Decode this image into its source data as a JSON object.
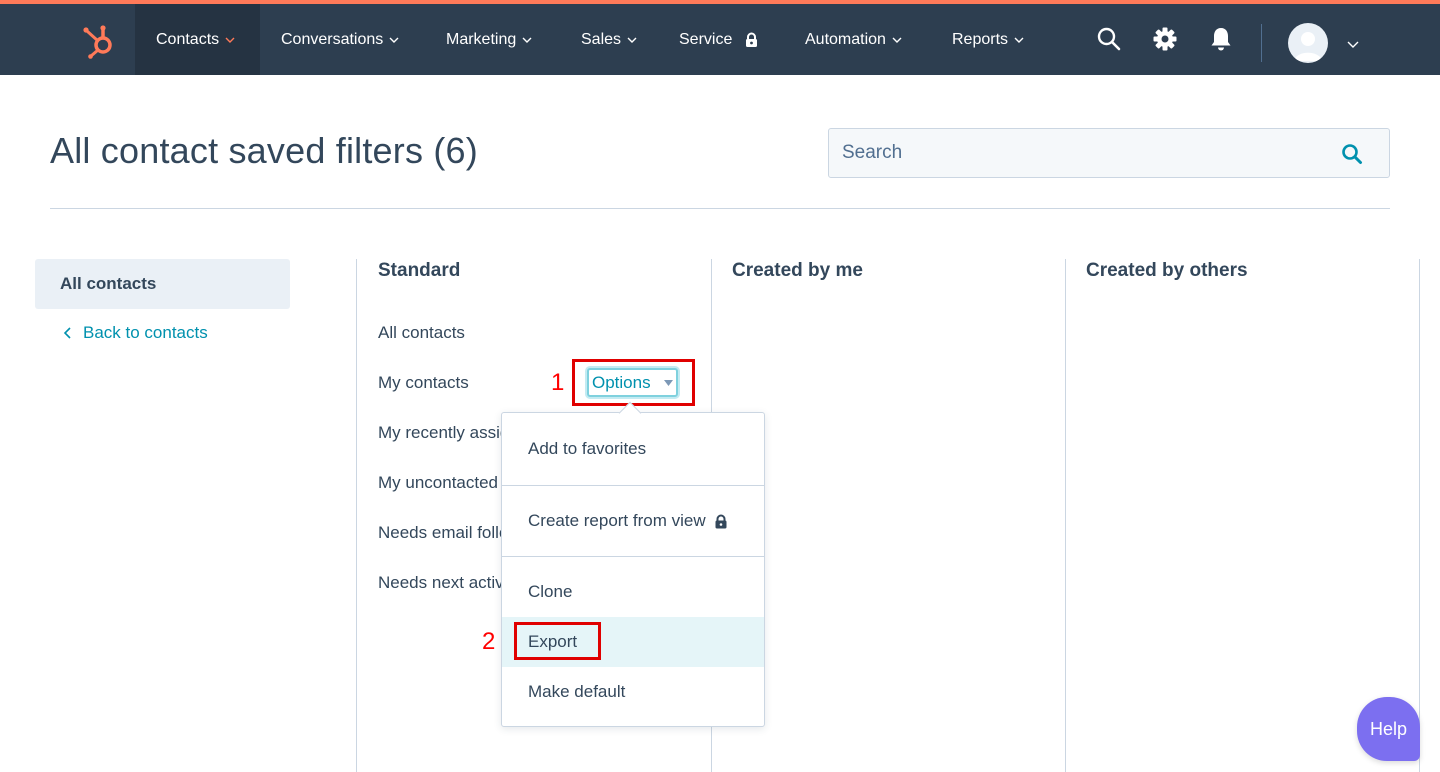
{
  "nav": {
    "items": [
      {
        "label": "Contacts"
      },
      {
        "label": "Conversations"
      },
      {
        "label": "Marketing"
      },
      {
        "label": "Sales"
      },
      {
        "label": "Service"
      },
      {
        "label": "Automation"
      },
      {
        "label": "Reports"
      }
    ],
    "icons": [
      "hubspot-logo-icon",
      "search-icon",
      "gear-icon",
      "bell-icon",
      "lock-icon",
      "avatar",
      "chevron-down-icon"
    ]
  },
  "page": {
    "title": "All contact saved filters (6)",
    "search_placeholder": "Search"
  },
  "sidebar": {
    "active_label": "All contacts",
    "back_label": "Back to contacts"
  },
  "columns": {
    "standard": {
      "heading": "Standard",
      "items": [
        "All contacts",
        "My contacts",
        "My recently assigned contacts",
        "My uncontacted contacts",
        "Needs email follow up",
        "Needs next activity date"
      ]
    },
    "created_by_me": {
      "heading": "Created by me"
    },
    "created_by_others": {
      "heading": "Created by others"
    }
  },
  "options_button": {
    "label": "Options"
  },
  "dropdown": {
    "items": [
      "Add to favorites",
      "Create report from view",
      "Clone",
      "Export",
      "Make default"
    ],
    "highlighted": "Export"
  },
  "annotations": {
    "step1": "1",
    "step2": "2"
  },
  "help": {
    "label": "Help"
  },
  "colors": {
    "nav_bg": "#2d3e50",
    "accent_orange": "#ff7a59",
    "link_teal": "#0091ae",
    "annotation_red": "#e00000",
    "help_purple": "#7c6ff0"
  }
}
